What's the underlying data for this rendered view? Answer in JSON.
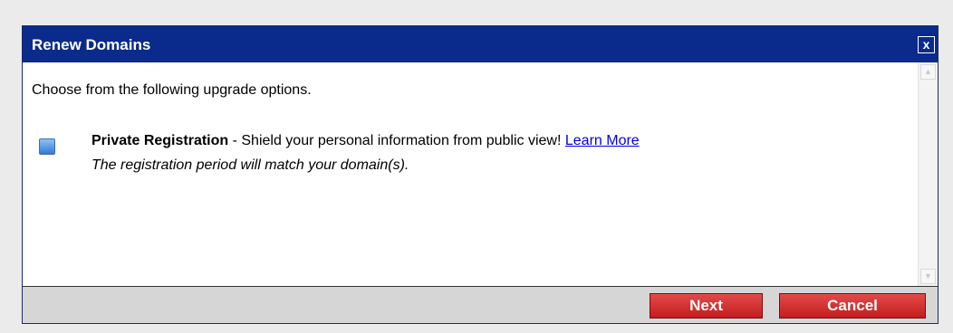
{
  "dialog": {
    "title": "Renew Domains",
    "close_label": "x"
  },
  "content": {
    "intro": "Choose from the following upgrade options.",
    "option": {
      "name": "Private Registration",
      "separator": " - ",
      "description": "Shield your personal information from public view! ",
      "link": "Learn More",
      "note": "The registration period will match your domain(s).",
      "checked": false
    }
  },
  "footer": {
    "next_label": "Next",
    "cancel_label": "Cancel"
  },
  "colors": {
    "titlebar": "#0a2a8c",
    "button": "#d12a2a",
    "link": "#0000ee"
  }
}
